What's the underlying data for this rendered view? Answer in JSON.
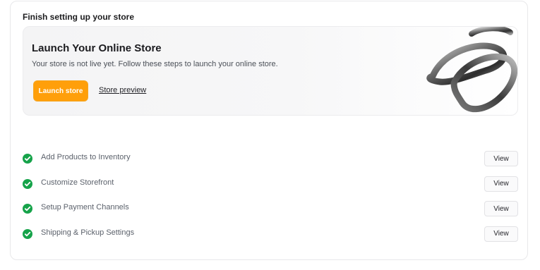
{
  "card": {
    "title": "Finish setting up your store"
  },
  "banner": {
    "title": "Launch Your Online Store",
    "subtitle": "Your store is not live yet. Follow these steps to launch your online store.",
    "launch_label": "Launch store",
    "preview_label": "Store preview",
    "accent": "#ff9f0a"
  },
  "steps": [
    {
      "label": "Add Products to Inventory",
      "action": "View",
      "done": true
    },
    {
      "label": "Customize Storefront",
      "action": "View",
      "done": true
    },
    {
      "label": "Setup Payment Channels",
      "action": "View",
      "done": true
    },
    {
      "label": "Shipping & Pickup Settings",
      "action": "View",
      "done": true
    }
  ],
  "colors": {
    "check": "#16a34a",
    "brand": "#ff9f0a"
  }
}
